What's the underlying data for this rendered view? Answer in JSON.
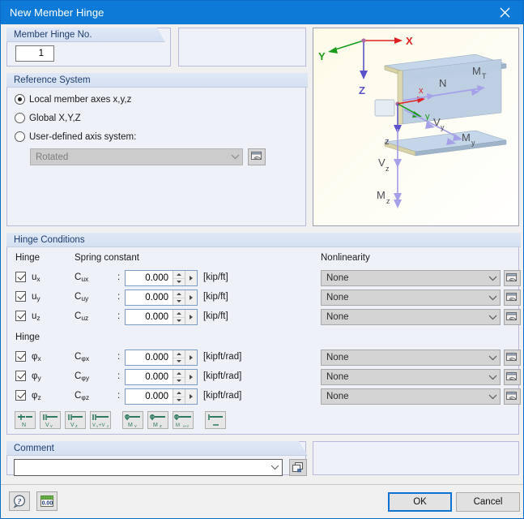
{
  "window": {
    "title": "New Member Hinge",
    "close_icon": "close-icon"
  },
  "hinge_no": {
    "header": "Member Hinge No.",
    "value": "1"
  },
  "reference_system": {
    "header": "Reference System",
    "options": [
      {
        "label": "Local member axes x,y,z",
        "selected": true
      },
      {
        "label": "Global X,Y,Z",
        "selected": false
      },
      {
        "label": "User-defined axis system:",
        "selected": false
      }
    ],
    "axis_combo_value": "Rotated",
    "axis_combo_disabled": true,
    "axis_pick_icon": "pick-window-icon"
  },
  "graphic": {
    "global_axes": [
      {
        "label": "X",
        "color": "#e02020"
      },
      {
        "label": "Y",
        "color": "#1a9c1a"
      },
      {
        "label": "Z",
        "color": "#5a52c8"
      }
    ],
    "local_axes": [
      {
        "label": "x",
        "color": "#e02020"
      },
      {
        "label": "y",
        "color": "#1a9c1a"
      },
      {
        "label": "z",
        "color": "#5a52c8"
      }
    ],
    "force_labels": [
      "N",
      "M",
      "V",
      "V",
      "M",
      "M"
    ],
    "annotations": [
      "N",
      "MT",
      "Vy",
      "My",
      "Vz",
      "Mz"
    ],
    "beam_color": "#aec4dd",
    "arrow_color": "#a6a0e8"
  },
  "hinge_conditions": {
    "header": "Hinge Conditions",
    "col_hinge": "Hinge",
    "col_spring": "Spring constant",
    "col_nonlinearity": "Nonlinearity",
    "col_hinge2": "Hinge",
    "translation_rows": [
      {
        "checked": true,
        "dof": "u",
        "sub": "x",
        "spring": "C",
        "spring_sub": "ux",
        "colon": ":",
        "value": "0.000",
        "unit": "[kip/ft]",
        "nonlinearity": "None"
      },
      {
        "checked": true,
        "dof": "u",
        "sub": "y",
        "spring": "C",
        "spring_sub": "uy",
        "colon": ":",
        "value": "0.000",
        "unit": "[kip/ft]",
        "nonlinearity": "None"
      },
      {
        "checked": true,
        "dof": "u",
        "sub": "z",
        "spring": "C",
        "spring_sub": "uz",
        "colon": ":",
        "value": "0.000",
        "unit": "[kip/ft]",
        "nonlinearity": "None"
      }
    ],
    "rotation_rows": [
      {
        "checked": true,
        "dof": "φ",
        "sub": "x",
        "spring": "C",
        "spring_sub": "φx",
        "colon": ":",
        "value": "0.000",
        "unit": "[kipft/rad]",
        "nonlinearity": "None"
      },
      {
        "checked": true,
        "dof": "φ",
        "sub": "y",
        "spring": "C",
        "spring_sub": "φy",
        "colon": ":",
        "value": "0.000",
        "unit": "[kipft/rad]",
        "nonlinearity": "None"
      },
      {
        "checked": true,
        "dof": "φ",
        "sub": "z",
        "spring": "C",
        "spring_sub": "φz",
        "colon": ":",
        "value": "0.000",
        "unit": "[kipft/rad]",
        "nonlinearity": "None"
      }
    ],
    "nonlinearity_pick_icon": "pick-window-icon",
    "spinner_up_icon": "spinner-up-icon",
    "spinner_down_icon": "spinner-down-icon",
    "spinner_more_icon": "spinner-more-icon",
    "preset_buttons": [
      {
        "label": "N",
        "name": "preset-n"
      },
      {
        "label": "Vy",
        "name": "preset-vy"
      },
      {
        "label": "Vz",
        "name": "preset-vz"
      },
      {
        "label": "Vy+Vz",
        "name": "preset-vy-vz"
      },
      {
        "label": "My",
        "name": "preset-my"
      },
      {
        "label": "Mz",
        "name": "preset-mz"
      },
      {
        "label": "My+z",
        "name": "preset-my-z"
      },
      {
        "label": "",
        "name": "preset-none"
      }
    ]
  },
  "comment": {
    "header": "Comment",
    "value": "",
    "placeholder": "",
    "pick_icon": "comment-list-icon"
  },
  "bottom": {
    "help_icon": "help-icon",
    "units_icon": "units-icon",
    "units_label": "0.00",
    "ok_label": "OK",
    "cancel_label": "Cancel"
  },
  "colors": {
    "title_bar": "#0c7ad6",
    "accent": "#0a73d4",
    "group_bg": "#eef1f8",
    "dialog_bg": "#f0f0f0"
  }
}
